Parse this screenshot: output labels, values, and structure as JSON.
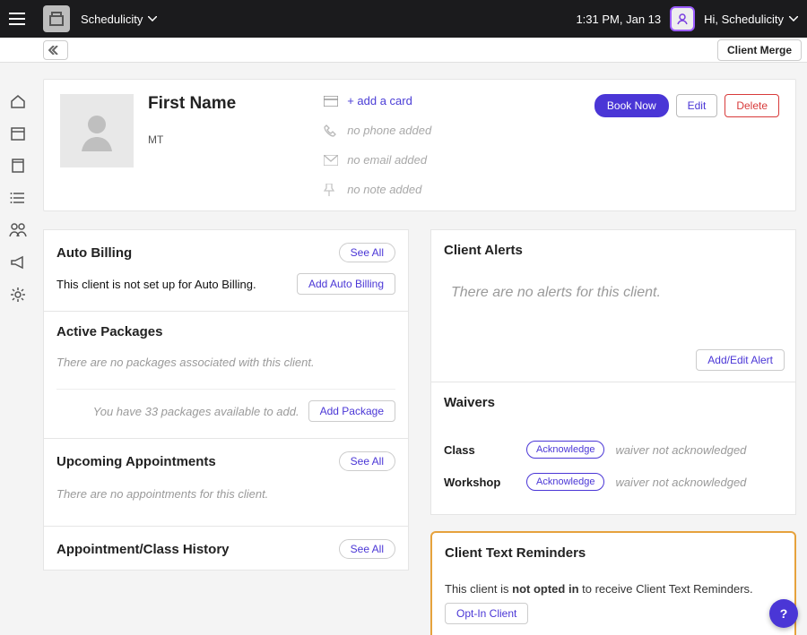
{
  "topbar": {
    "app_name": "Schedulicity",
    "time_text": "1:31 PM, Jan 13",
    "greeting": "Hi, Schedulicity"
  },
  "subbar": {
    "merge_label": "Client Merge"
  },
  "client": {
    "name": "First Name",
    "location": "MT",
    "add_card_label": "+ add a card",
    "no_phone": "no phone added",
    "no_email": "no email added",
    "no_note": "no note added",
    "book_now": "Book Now",
    "edit": "Edit",
    "delete": "Delete"
  },
  "auto_billing": {
    "title": "Auto Billing",
    "see_all": "See All",
    "body": "This client is not set up for Auto Billing.",
    "button": "Add Auto Billing"
  },
  "packages": {
    "title": "Active Packages",
    "empty": "There are no packages associated with this client.",
    "hint": "You have 33 packages available to add.",
    "button": "Add Package"
  },
  "upcoming": {
    "title": "Upcoming Appointments",
    "see_all": "See All",
    "empty": "There are no appointments for this client."
  },
  "history": {
    "title": "Appointment/Class History",
    "see_all": "See All"
  },
  "alerts": {
    "title": "Client Alerts",
    "empty": "There are no alerts for this client.",
    "button": "Add/Edit Alert"
  },
  "waivers": {
    "title": "Waivers",
    "rows": [
      {
        "label": "Class",
        "btn": "Acknowledge",
        "status": "waiver not acknowledged"
      },
      {
        "label": "Workshop",
        "btn": "Acknowledge",
        "status": "waiver not acknowledged"
      }
    ]
  },
  "reminders": {
    "title": "Client Text Reminders",
    "text_before": "This client is ",
    "text_bold": "not opted in",
    "text_after": " to receive Client Text Reminders.",
    "button": "Opt-In Client"
  },
  "colors": {
    "primary": "#4a36d6",
    "warning_border": "#e6a23c",
    "danger": "#d83a3a"
  }
}
